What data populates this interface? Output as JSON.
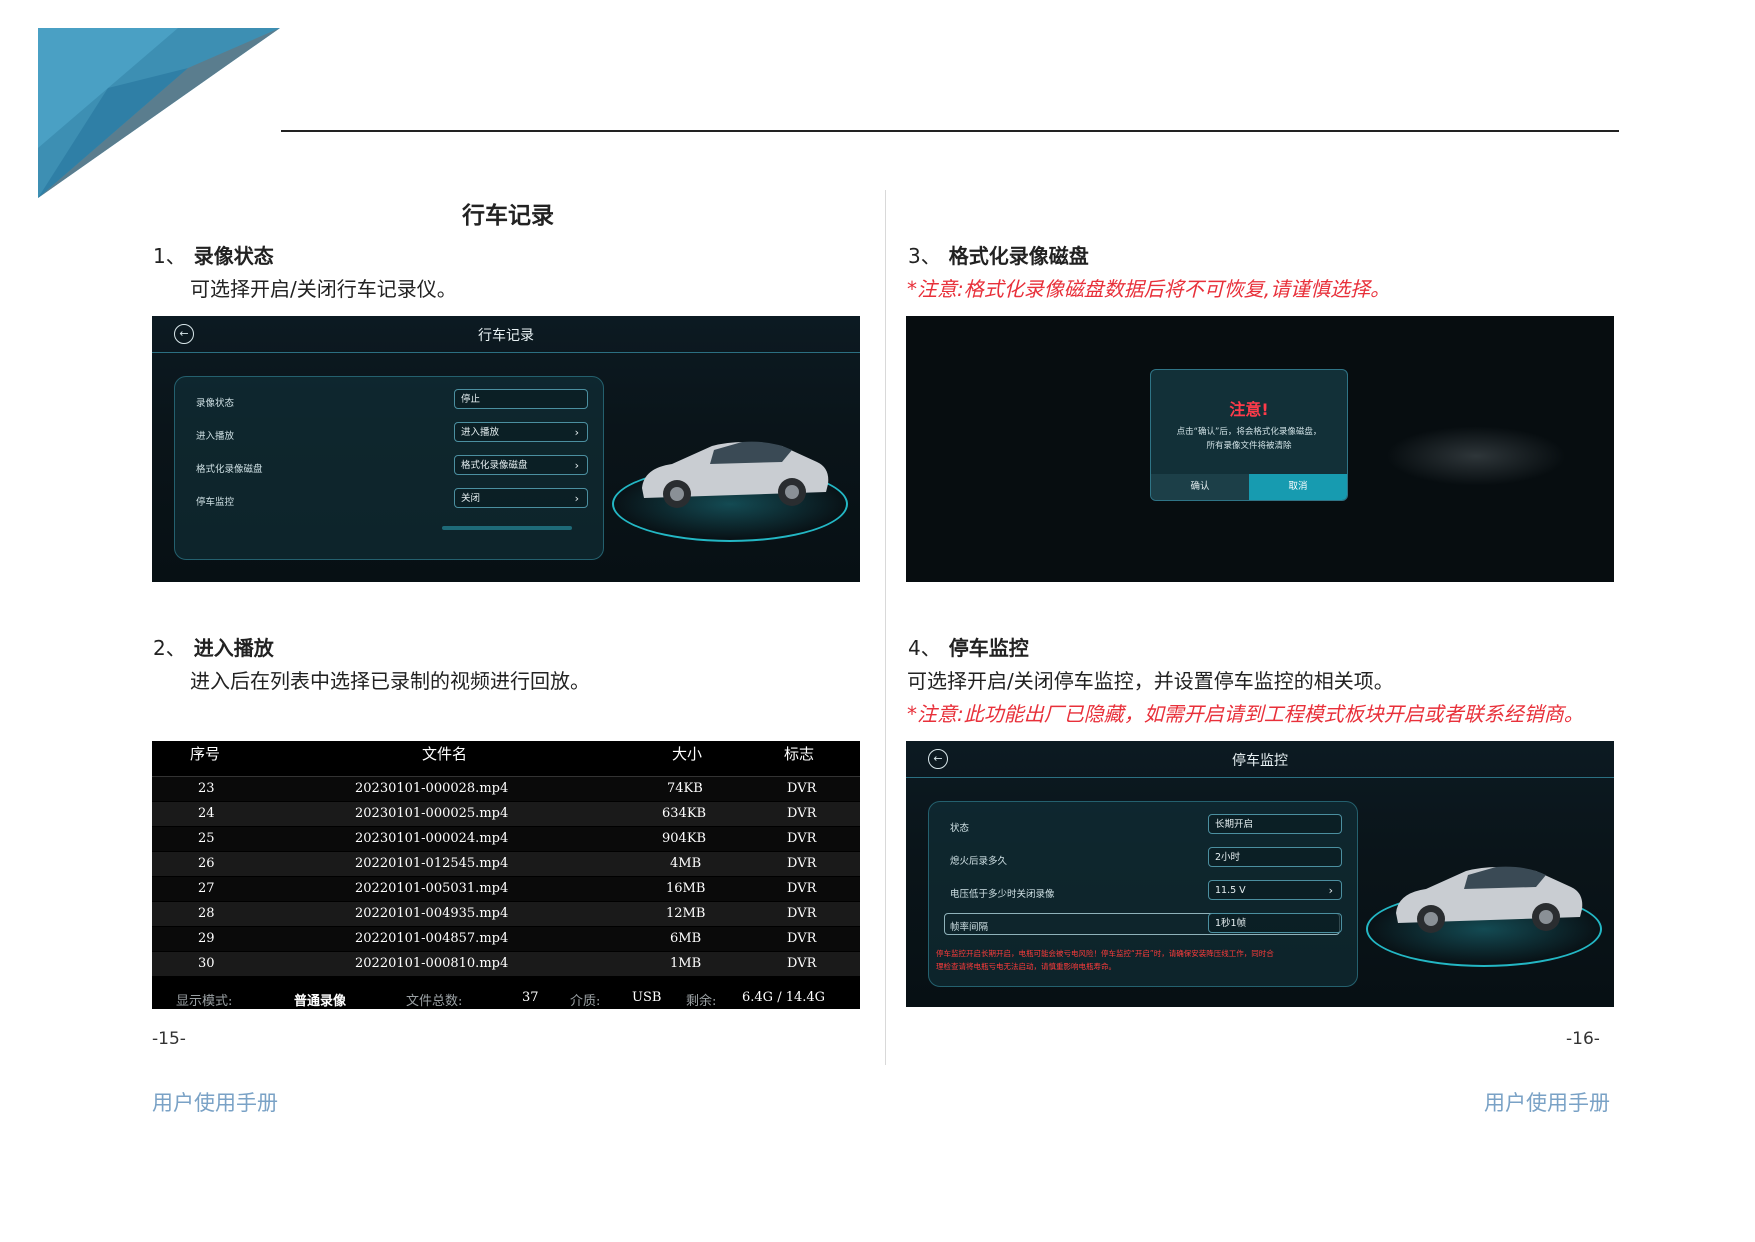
{
  "title": "行车记录",
  "sections": [
    {
      "num": "1、",
      "label": "录像状态",
      "desc": "可选择开启/关闭行车记录仪。"
    },
    {
      "num": "2、",
      "label": "进入播放",
      "desc": "进入后在列表中选择已录制的视频进行回放。"
    },
    {
      "num": "3、",
      "label": "格式化录像磁盘",
      "warn": "*注意:格式化录像磁盘数据后将不可恢复,请谨慎选择。"
    },
    {
      "num": "4、",
      "label": "停车监控",
      "desc": "可选择开启/关闭停车监控，并设置停车监控的相关项。",
      "warn": "*注意:此功能出厂已隐藏，如需开启请到工程模式板块开启或者联系经销商。"
    }
  ],
  "screen1": {
    "title": "行车记录",
    "rows": [
      {
        "label": "录像状态",
        "value": "停止",
        "chevron": ""
      },
      {
        "label": "进入播放",
        "value": "进入播放",
        "chevron": "›"
      },
      {
        "label": "格式化录像磁盘",
        "value": "格式化录像磁盘",
        "chevron": "›"
      },
      {
        "label": "停车监控",
        "value": "关闭",
        "chevron": "›"
      }
    ]
  },
  "screen3": {
    "dialog_title": "注意!",
    "dialog_line1": "点击“确认”后，将会格式化录像磁盘，",
    "dialog_line2": "所有录像文件将被清除",
    "confirm": "确认",
    "cancel": "取消"
  },
  "screen2": {
    "headers": [
      "序号",
      "文件名",
      "大小",
      "标志"
    ],
    "rows": [
      [
        "23",
        "20230101-000028.mp4",
        "74KB",
        "DVR"
      ],
      [
        "24",
        "20230101-000025.mp4",
        "634KB",
        "DVR"
      ],
      [
        "25",
        "20230101-000024.mp4",
        "904KB",
        "DVR"
      ],
      [
        "26",
        "20220101-012545.mp4",
        "4MB",
        "DVR"
      ],
      [
        "27",
        "20220101-005031.mp4",
        "16MB",
        "DVR"
      ],
      [
        "28",
        "20220101-004935.mp4",
        "12MB",
        "DVR"
      ],
      [
        "29",
        "20220101-004857.mp4",
        "6MB",
        "DVR"
      ],
      [
        "30",
        "20220101-000810.mp4",
        "1MB",
        "DVR"
      ]
    ],
    "footer": {
      "mode_label": "显示模式:",
      "mode_value": "普通录像",
      "total_label": "文件总数:",
      "total_value": "37",
      "media_label": "介质:",
      "media_value": "USB",
      "remain_label": "剩余:",
      "remain_value": "6.4G / 14.4G"
    }
  },
  "screen4": {
    "title": "停车监控",
    "rows": [
      {
        "label": "状态",
        "value": "长期开启",
        "chevron": ""
      },
      {
        "label": "熄火后录多久",
        "value": "2小时",
        "chevron": ""
      },
      {
        "label": "电压低于多少时关闭录像",
        "value": "11.5 V",
        "chevron": "›"
      },
      {
        "label": "帧率间隔",
        "value": "1秒1帧",
        "chevron": ""
      }
    ],
    "note_line1": "停车监控开启长期开启，电瓶可能会被亏电风险！停车监控“开启”时，请确保安装降压线工作，同时合",
    "note_line2": "理检查请将电瓶亏电无法启动，请慎重影响电瓶寿命。"
  },
  "page_left": "-15-",
  "page_right": "-16-",
  "footer_left": "用户使用手册",
  "footer_right": "用户使用手册",
  "colors": {
    "accent": "#23b7c4",
    "warn": "#e8303a",
    "footer": "#7aa2c6"
  }
}
